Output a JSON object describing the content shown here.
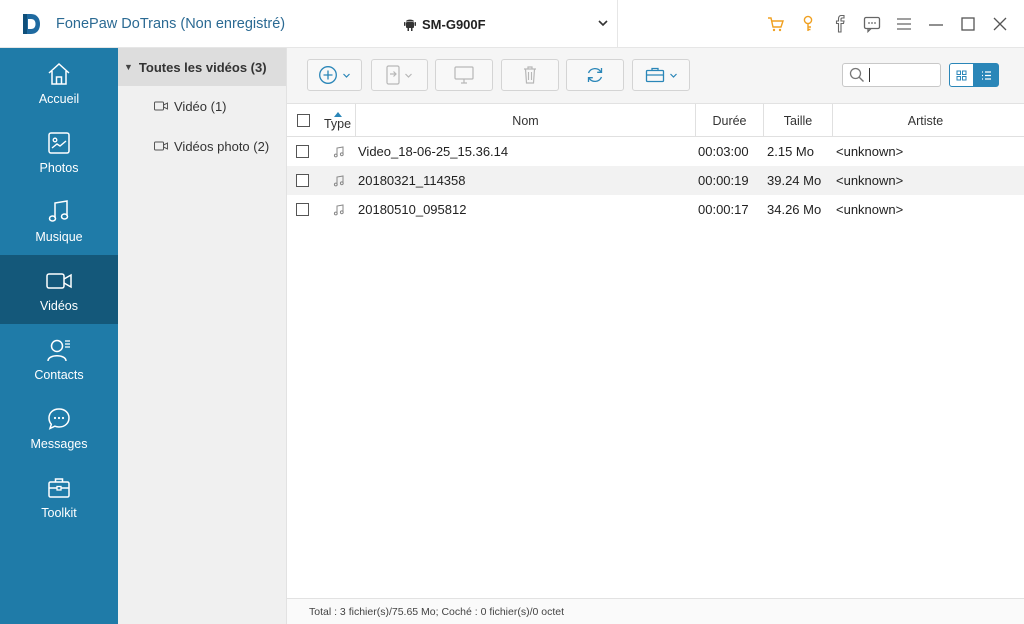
{
  "app": {
    "title": "FonePaw DoTrans (Non enregistré)",
    "device": "SM-G900F",
    "accent": "#1f7ba8",
    "accent_dark": "#14587a",
    "logo_color": "#1f6aa0"
  },
  "titlebar_icons": [
    "cart-icon",
    "key-icon",
    "facebook-icon",
    "feedback-icon",
    "menu-icon",
    "minimize-icon",
    "maximize-icon",
    "close-icon"
  ],
  "sidebar": {
    "items": [
      {
        "label": "Accueil",
        "icon": "home-icon",
        "active": false
      },
      {
        "label": "Photos",
        "icon": "photo-icon",
        "active": false
      },
      {
        "label": "Musique",
        "icon": "music-icon",
        "active": false
      },
      {
        "label": "Vidéos",
        "icon": "video-icon",
        "active": true
      },
      {
        "label": "Contacts",
        "icon": "contacts-icon",
        "active": false
      },
      {
        "label": "Messages",
        "icon": "messages-icon",
        "active": false
      },
      {
        "label": "Toolkit",
        "icon": "toolkit-icon",
        "active": false
      }
    ]
  },
  "categories": {
    "all": "Toutes les vidéos (3)",
    "sub": [
      "Vidéo (1)",
      "Vidéos photo (2)"
    ]
  },
  "toolbar": {
    "buttons": [
      "add-button",
      "export-device-button",
      "export-pc-button",
      "delete-button",
      "refresh-button",
      "toolbox-button"
    ],
    "search_placeholder": ""
  },
  "table": {
    "columns": {
      "type": "Type",
      "name": "Nom",
      "duration": "Durée",
      "size": "Taille",
      "artist": "Artiste"
    },
    "rows": [
      {
        "name": "Video_18-06-25_15.36.14",
        "duration": "00:03:00",
        "size": "2.15 Mo",
        "artist": "<unknown>"
      },
      {
        "name": "20180321_114358",
        "duration": "00:00:19",
        "size": "39.24 Mo",
        "artist": "<unknown>"
      },
      {
        "name": "20180510_095812",
        "duration": "00:00:17",
        "size": "34.26 Mo",
        "artist": "<unknown>"
      }
    ]
  },
  "status": "Total : 3 fichier(s)/75.65 Mo; Coché : 0 fichier(s)/0 octet"
}
